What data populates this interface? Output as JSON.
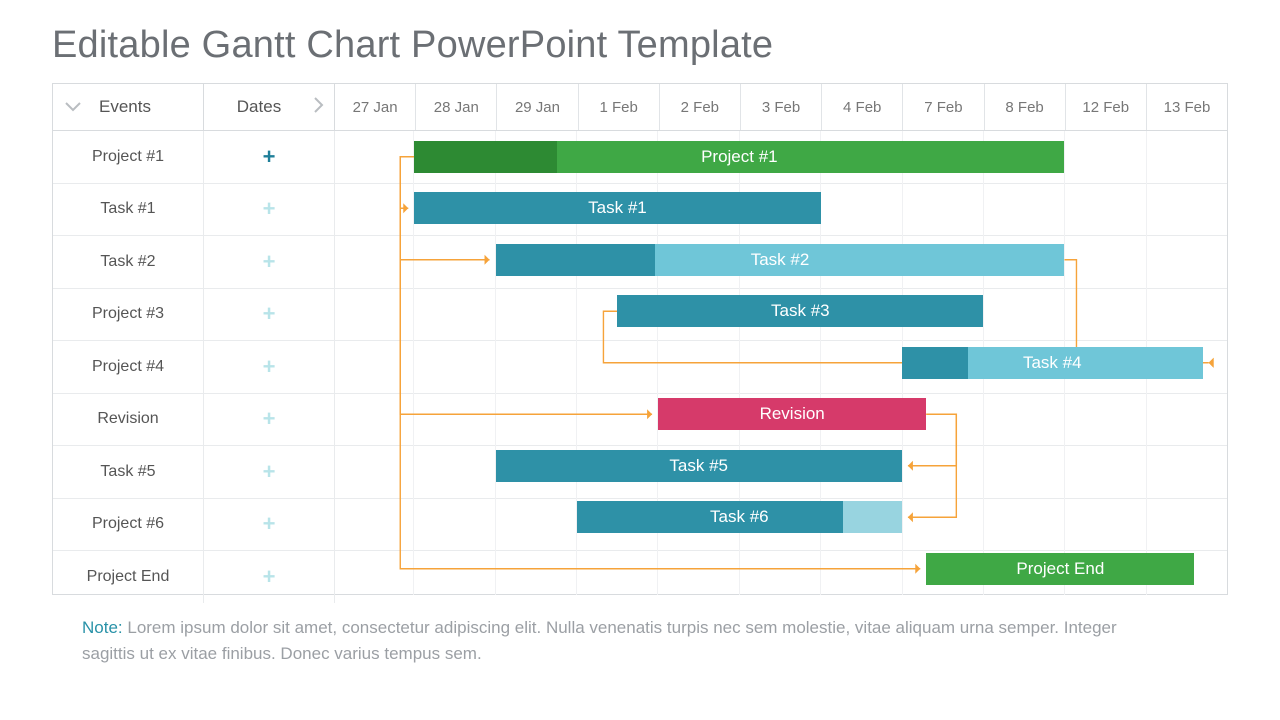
{
  "title": "Editable Gantt Chart PowerPoint Template",
  "headers": {
    "events": "Events",
    "dates": "Dates"
  },
  "timeline": [
    "27 Jan",
    "28 Jan",
    "29 Jan",
    "1 Feb",
    "2 Feb",
    "3 Feb",
    "4 Feb",
    "7 Feb",
    "8 Feb",
    "12 Feb",
    "13 Feb"
  ],
  "rows": [
    {
      "label": "Project #1",
      "plus": "strong"
    },
    {
      "label": "Task #1",
      "plus": "light"
    },
    {
      "label": "Task #2",
      "plus": "light"
    },
    {
      "label": "Project #3",
      "plus": "light"
    },
    {
      "label": "Project #4",
      "plus": "light"
    },
    {
      "label": "Revision",
      "plus": "light"
    },
    {
      "label": "Task #5",
      "plus": "light"
    },
    {
      "label": "Project #6",
      "plus": "light"
    },
    {
      "label": "Project End",
      "plus": "light"
    }
  ],
  "colors": {
    "green": "#3fa845",
    "green_dark": "#2d8a33",
    "teal": "#2e91a7",
    "teal_light": "#6fc6d8",
    "teal_soft": "#98d4e0",
    "pink": "#d63a6a",
    "link": "#f6a33a"
  },
  "note_label": "Note:",
  "note_text": " Lorem ipsum dolor sit amet, consectetur adipiscing elit. Nulla venenatis turpis nec sem molestie, vitae aliquam urna semper. Integer sagittis ut ex vitae finibus. Donec varius tempus sem.",
  "chart_data": {
    "type": "gantt",
    "x_categories": [
      "27 Jan",
      "28 Jan",
      "29 Jan",
      "1 Feb",
      "2 Feb",
      "3 Feb",
      "4 Feb",
      "7 Feb",
      "8 Feb",
      "12 Feb",
      "13 Feb"
    ],
    "tasks": [
      {
        "row": 0,
        "label": "Project #1",
        "start": 1,
        "end": 9,
        "color": "green",
        "progress": 0.22
      },
      {
        "row": 1,
        "label": "Task #1",
        "start": 1,
        "end": 6,
        "color": "teal"
      },
      {
        "row": 2,
        "label": "Task #2",
        "start": 2,
        "end": 9,
        "color": "teal_light",
        "progress_color": "teal",
        "progress": 0.28
      },
      {
        "row": 3,
        "label": "Task #3",
        "start": 3.5,
        "end": 8,
        "color": "teal"
      },
      {
        "row": 4,
        "label": "Task #4",
        "start": 7,
        "end": 10.7,
        "color": "teal_light",
        "progress_color": "teal",
        "progress": 0.22
      },
      {
        "row": 5,
        "label": "Revision",
        "start": 4,
        "end": 7.3,
        "color": "pink"
      },
      {
        "row": 6,
        "label": "Task #5",
        "start": 2,
        "end": 7,
        "color": "teal"
      },
      {
        "row": 7,
        "label": "Task #6",
        "start": 3,
        "end": 7,
        "color": "teal",
        "tail_color": "teal_soft",
        "tail": 0.18
      },
      {
        "row": 8,
        "label": "Project End",
        "start": 7.3,
        "end": 10.6,
        "color": "green"
      }
    ],
    "dependencies": [
      {
        "from_row": 0,
        "to_row": 1,
        "kind": "start-start"
      },
      {
        "from_row": 0,
        "to_row": 2,
        "kind": "start-start"
      },
      {
        "from_row": 0,
        "to_row": 5,
        "kind": "start-start"
      },
      {
        "from_row": 0,
        "to_row": 8,
        "kind": "start-start"
      },
      {
        "from_row": 2,
        "to_row": 4,
        "kind": "finish-start"
      },
      {
        "from_row": 3,
        "to_row": 4,
        "kind": "start-finish"
      },
      {
        "from_row": 5,
        "to_row": 6,
        "kind": "finish-finish-down"
      },
      {
        "from_row": 5,
        "to_row": 7,
        "kind": "finish-finish-down"
      }
    ]
  }
}
